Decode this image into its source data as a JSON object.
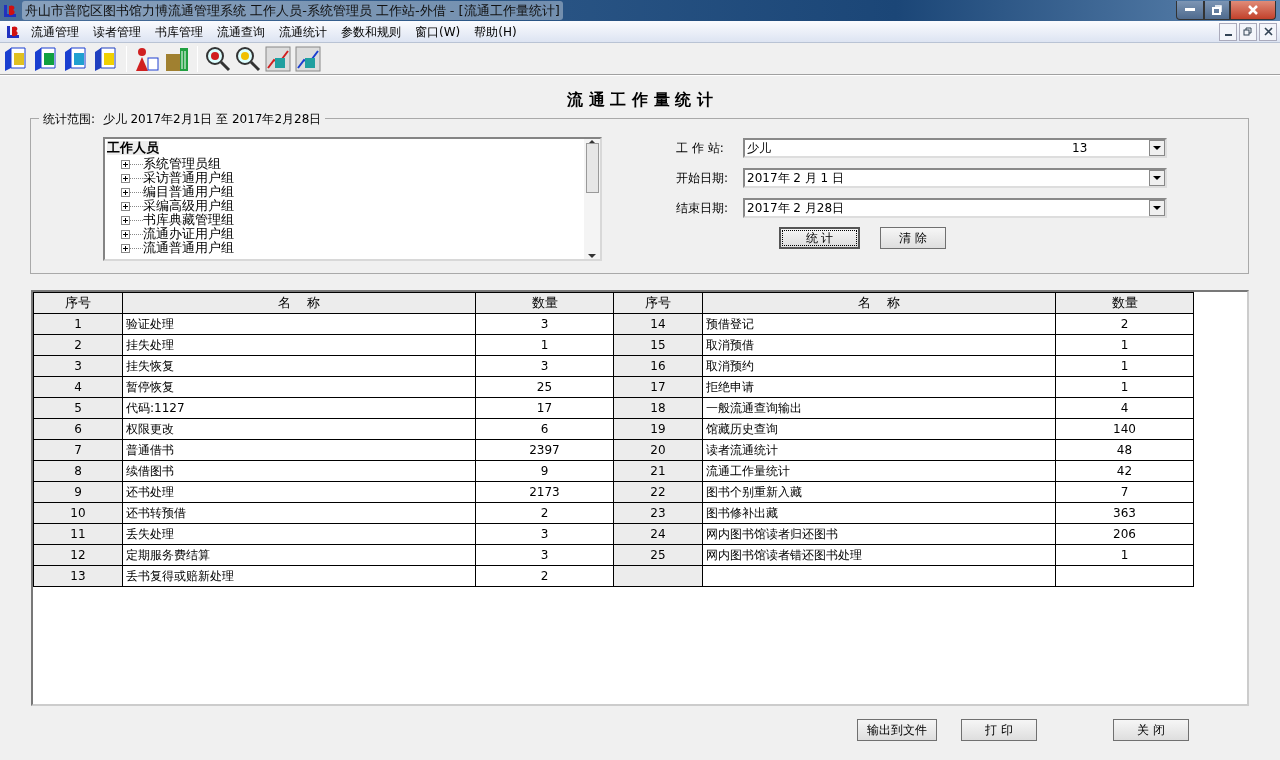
{
  "window": {
    "title": "舟山市普陀区图书馆力博流通管理系统 工作人员-系统管理员 工作站-外借 - [流通工作量统计]"
  },
  "menu": [
    "流通管理",
    "读者管理",
    "书库管理",
    "流通查询",
    "流通统计",
    "参数和规则",
    "窗口(W)",
    "帮助(H)"
  ],
  "heading": "流 通 工 作 量 统 计",
  "range": {
    "label": "统计范围:",
    "value": "少儿 2017年2月1日 至 2017年2月28日"
  },
  "tree": {
    "root": "工作人员",
    "children": [
      {
        "label": "系统管理员组"
      },
      {
        "label": "采访普通用户组"
      },
      {
        "label": "编目普通用户组"
      },
      {
        "label": "采编高级用户组"
      },
      {
        "label": "书库典藏管理组"
      },
      {
        "label": "流通办证用户组"
      },
      {
        "label": "流通普通用户组"
      }
    ]
  },
  "fields": [
    {
      "label": "工 作 站:",
      "value": "少儿",
      "code": "13"
    },
    {
      "label": "开始日期:",
      "value": "2017年 2 月 1 日"
    },
    {
      "label": "结束日期:",
      "value": "2017年 2 月28日"
    }
  ],
  "actions": [
    {
      "label": "统 计",
      "focused": true
    },
    {
      "label": "清 除",
      "focused": false
    }
  ],
  "table": {
    "columns": [
      "序号",
      "名    称",
      "数量",
      "序号",
      "名    称",
      "数量"
    ],
    "rows": [
      {
        "no": "1",
        "name": "验证处理",
        "count": "3"
      },
      {
        "no": "2",
        "name": "挂失处理",
        "count": "1"
      },
      {
        "no": "3",
        "name": "挂失恢复",
        "count": "3"
      },
      {
        "no": "4",
        "name": "暂停恢复",
        "count": "25"
      },
      {
        "no": "5",
        "name": "代码:1127",
        "count": "17"
      },
      {
        "no": "6",
        "name": "权限更改",
        "count": "6"
      },
      {
        "no": "7",
        "name": "普通借书",
        "count": "2397"
      },
      {
        "no": "8",
        "name": "续借图书",
        "count": "9"
      },
      {
        "no": "9",
        "name": "还书处理",
        "count": "2173"
      },
      {
        "no": "10",
        "name": "还书转预借",
        "count": "2"
      },
      {
        "no": "11",
        "name": "丢失处理",
        "count": "3"
      },
      {
        "no": "12",
        "name": "定期服务费结算",
        "count": "3"
      },
      {
        "no": "13",
        "name": "丢书复得或赔新处理",
        "count": "2"
      },
      {
        "no": "14",
        "name": "预借登记",
        "count": "2"
      },
      {
        "no": "15",
        "name": "取消预借",
        "count": "1"
      },
      {
        "no": "16",
        "name": "取消预约",
        "count": "1"
      },
      {
        "no": "17",
        "name": "拒绝申请",
        "count": "1"
      },
      {
        "no": "18",
        "name": "一般流通查询输出",
        "count": "4"
      },
      {
        "no": "19",
        "name": "馆藏历史查询",
        "count": "140"
      },
      {
        "no": "20",
        "name": "读者流通统计",
        "count": "48"
      },
      {
        "no": "21",
        "name": "流通工作量统计",
        "count": "42"
      },
      {
        "no": "22",
        "name": "图书个别重新入藏",
        "count": "7"
      },
      {
        "no": "23",
        "name": "图书修补出藏",
        "count": "363"
      },
      {
        "no": "24",
        "name": "网内图书馆读者归还图书",
        "count": "206"
      },
      {
        "no": "25",
        "name": "网内图书馆读者错还图书处理",
        "count": "1"
      }
    ]
  },
  "footer_buttons": [
    "输出到文件",
    "打 印",
    "关 闭"
  ]
}
